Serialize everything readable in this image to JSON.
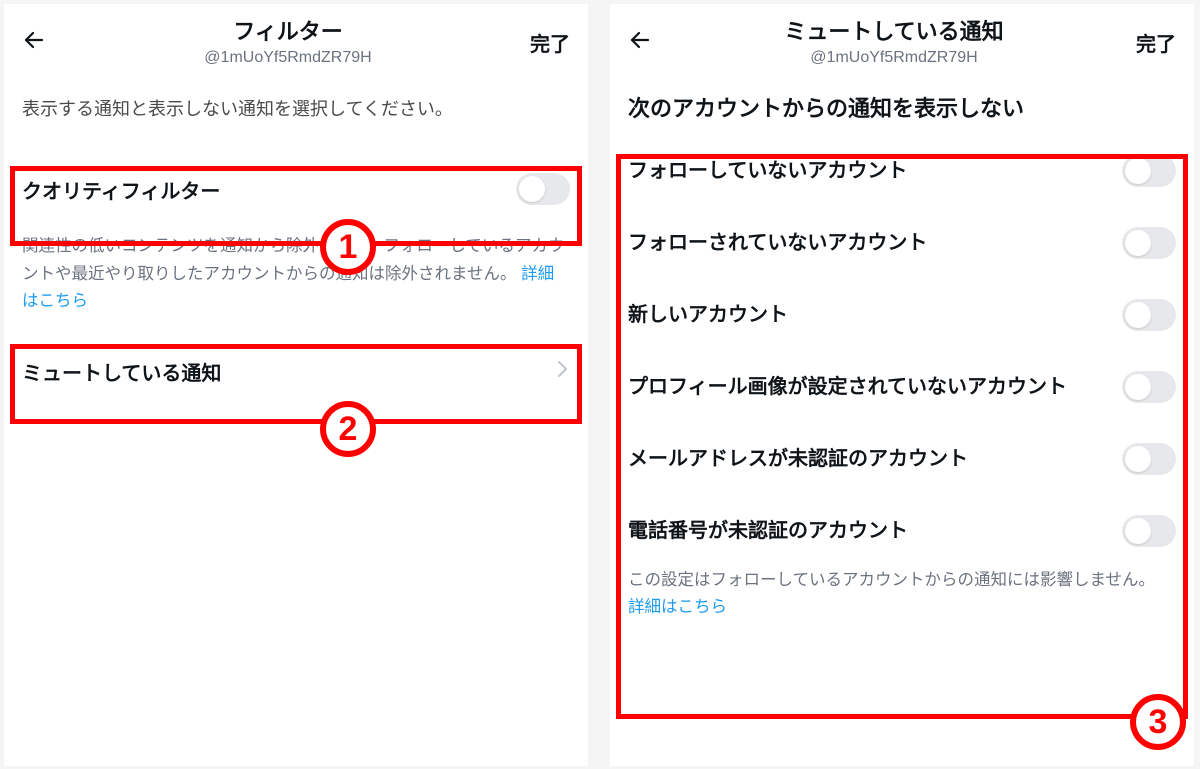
{
  "left": {
    "header": {
      "title": "フィルター",
      "subtitle": "@1mUoYf5RmdZR79H",
      "done": "完了"
    },
    "description": "表示する通知と表示しない通知を選択してください。",
    "quality_filter_label": "クオリティフィルター",
    "quality_help": "関連性の低いコンテンツを通知から除外します。フォローしているアカウントや最近やり取りしたアカウントからの通知は除外されません。",
    "learn_more": "詳細はこちら",
    "muted_label": "ミュートしている通知"
  },
  "right": {
    "header": {
      "title": "ミュートしている通知",
      "subtitle": "@1mUoYf5RmdZR79H",
      "done": "完了"
    },
    "section_heading": "次のアカウントからの通知を表示しない",
    "items": [
      "フォローしていないアカウント",
      "フォローされていないアカウント",
      "新しいアカウント",
      "プロフィール画像が設定されていないアカウント",
      "メールアドレスが未認証のアカウント",
      "電話番号が未認証のアカウント"
    ],
    "footer": "この設定はフォローしているアカウントからの通知には影響しません。",
    "learn_more": "詳細はこちら"
  },
  "badges": {
    "one": "1",
    "two": "2",
    "three": "3"
  }
}
